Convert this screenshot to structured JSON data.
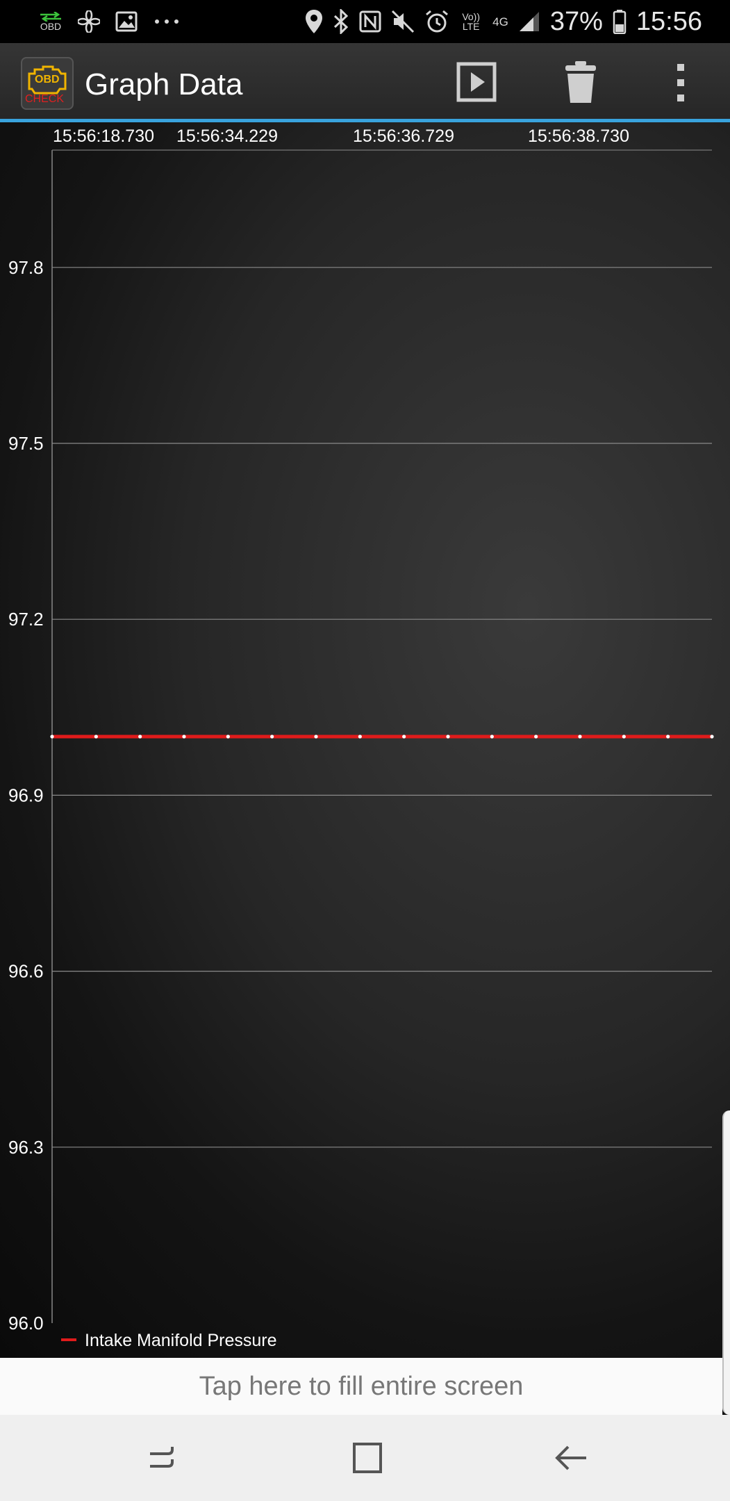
{
  "status_bar": {
    "left_icons": [
      "obd-notification-icon",
      "fan-icon",
      "image-icon",
      "more-notifications-icon"
    ],
    "obd_label": "OBD",
    "right_icons": [
      "location-icon",
      "bluetooth-icon",
      "nfc-icon",
      "mute-icon",
      "alarm-icon"
    ],
    "volte_label": "Vo)) LTE",
    "network_label": "4G",
    "battery": "37%",
    "time": "15:56"
  },
  "action_bar": {
    "app_icon_top": "OBD",
    "app_icon_bottom": "CHECK",
    "title": "Graph Data",
    "buttons": [
      "play-icon",
      "trash-icon",
      "overflow-menu-icon"
    ]
  },
  "chart_data": {
    "type": "line",
    "x_tick_labels": [
      "15:56:18.730",
      "15:56:34.229",
      "15:56:36.729",
      "15:56:38.730"
    ],
    "y_tick_labels": [
      "97.8",
      "97.5",
      "97.2",
      "96.9",
      "96.6",
      "96.3",
      "96.0"
    ],
    "ylim": [
      96.0,
      98.0
    ],
    "series": [
      {
        "name": "Intake Manifold Pressure",
        "color": "#e01b1b",
        "values": [
          97.0,
          97.0,
          97.0,
          97.0,
          97.0,
          97.0,
          97.0,
          97.0,
          97.0,
          97.0,
          97.0,
          97.0,
          97.0,
          97.0,
          97.0,
          97.0
        ]
      }
    ],
    "grid": true,
    "legend_position": "bottom-left"
  },
  "fill_screen_label": "Tap here to fill entire screen",
  "navigation": {
    "buttons": [
      "recent-apps-icon",
      "home-icon",
      "back-icon"
    ]
  }
}
